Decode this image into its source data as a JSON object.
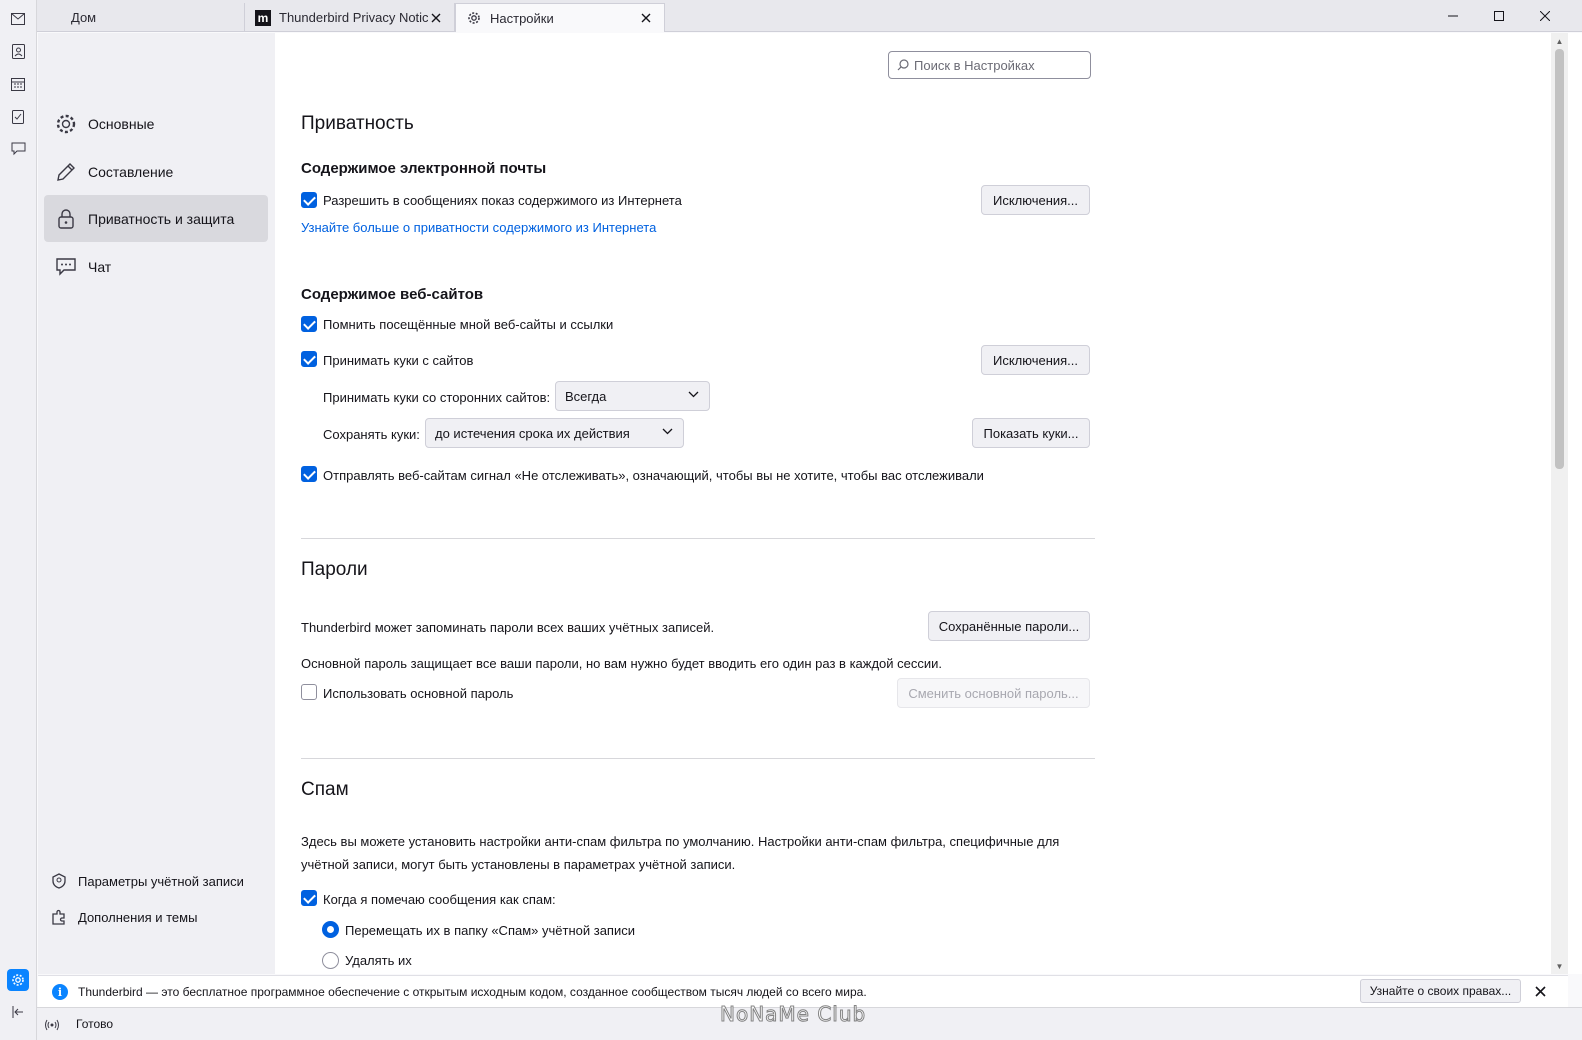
{
  "tabs": [
    {
      "label": "Дом",
      "icon": "mail-icon"
    },
    {
      "label": "Thunderbird Privacy Notice",
      "icon": "mozilla-m-icon"
    },
    {
      "label": "Настройки",
      "icon": "gear-icon"
    }
  ],
  "sidebar": {
    "categories": [
      {
        "label": "Основные",
        "icon": "gear-icon"
      },
      {
        "label": "Составление",
        "icon": "pencil-icon"
      },
      {
        "label": "Приватность и защита",
        "icon": "lock-icon"
      },
      {
        "label": "Чат",
        "icon": "chat-icon"
      }
    ],
    "footer": [
      {
        "label": "Параметры учётной записи",
        "icon": "account-settings-icon"
      },
      {
        "label": "Дополнения и темы",
        "icon": "puzzle-icon"
      }
    ]
  },
  "search": {
    "placeholder": "Поиск в Настройках"
  },
  "privacy": {
    "title": "Приватность",
    "mail_content": {
      "heading": "Содержимое электронной почты",
      "allow_remote": "Разрешить в сообщениях показ содержимого из Интернета",
      "exceptions_btn": "Исключения...",
      "learn_more": "Узнайте больше о приватности содержимого из Интернета"
    },
    "web_content": {
      "heading": "Содержимое веб-сайтов",
      "remember_sites": "Помнить посещённые мной веб-сайты и ссылки",
      "accept_cookies": "Принимать куки с сайтов",
      "exceptions_btn": "Исключения...",
      "third_party_label": "Принимать куки со сторонних сайтов:",
      "third_party_value": "Всегда",
      "keep_until_label": "Сохранять куки:",
      "keep_until_value": "до истечения срока их действия",
      "show_cookies_btn": "Показать куки...",
      "dnt": "Отправлять веб-сайтам сигнал «Не отслеживать», означающий, чтобы вы не хотите, чтобы вас отслеживали"
    }
  },
  "passwords": {
    "title": "Пароли",
    "remember_text": "Thunderbird может запоминать пароли всех ваших учётных записей.",
    "saved_btn": "Сохранённые пароли...",
    "primary_desc": "Основной пароль защищает все ваши пароли, но вам нужно будет вводить его один раз в каждой сессии.",
    "use_primary": "Использовать основной пароль",
    "change_primary_btn": "Сменить основной пароль..."
  },
  "spam": {
    "title": "Спам",
    "desc": "Здесь вы можете установить настройки анти-спам фильтра по умолчанию. Настройки анти-спам фильтра, специфичные для учётной записи, могут быть установлены в параметрах учётной записи.",
    "when_mark": "Когда я помечаю сообщения как спам:",
    "move_option": "Перемещать их в папку «Спам» учётной записи",
    "delete_option": "Удалять их"
  },
  "notification": {
    "text": "Thunderbird — это бесплатное программное обеспечение с открытым исходным кодом, созданное сообществом тысяч людей со всего мира.",
    "button": "Узнайте о своих правах..."
  },
  "status": {
    "text": "Готово"
  },
  "watermark": "NoNaMe Club",
  "colors": {
    "accent": "#0061e0",
    "active_space": "#0a84ff"
  }
}
